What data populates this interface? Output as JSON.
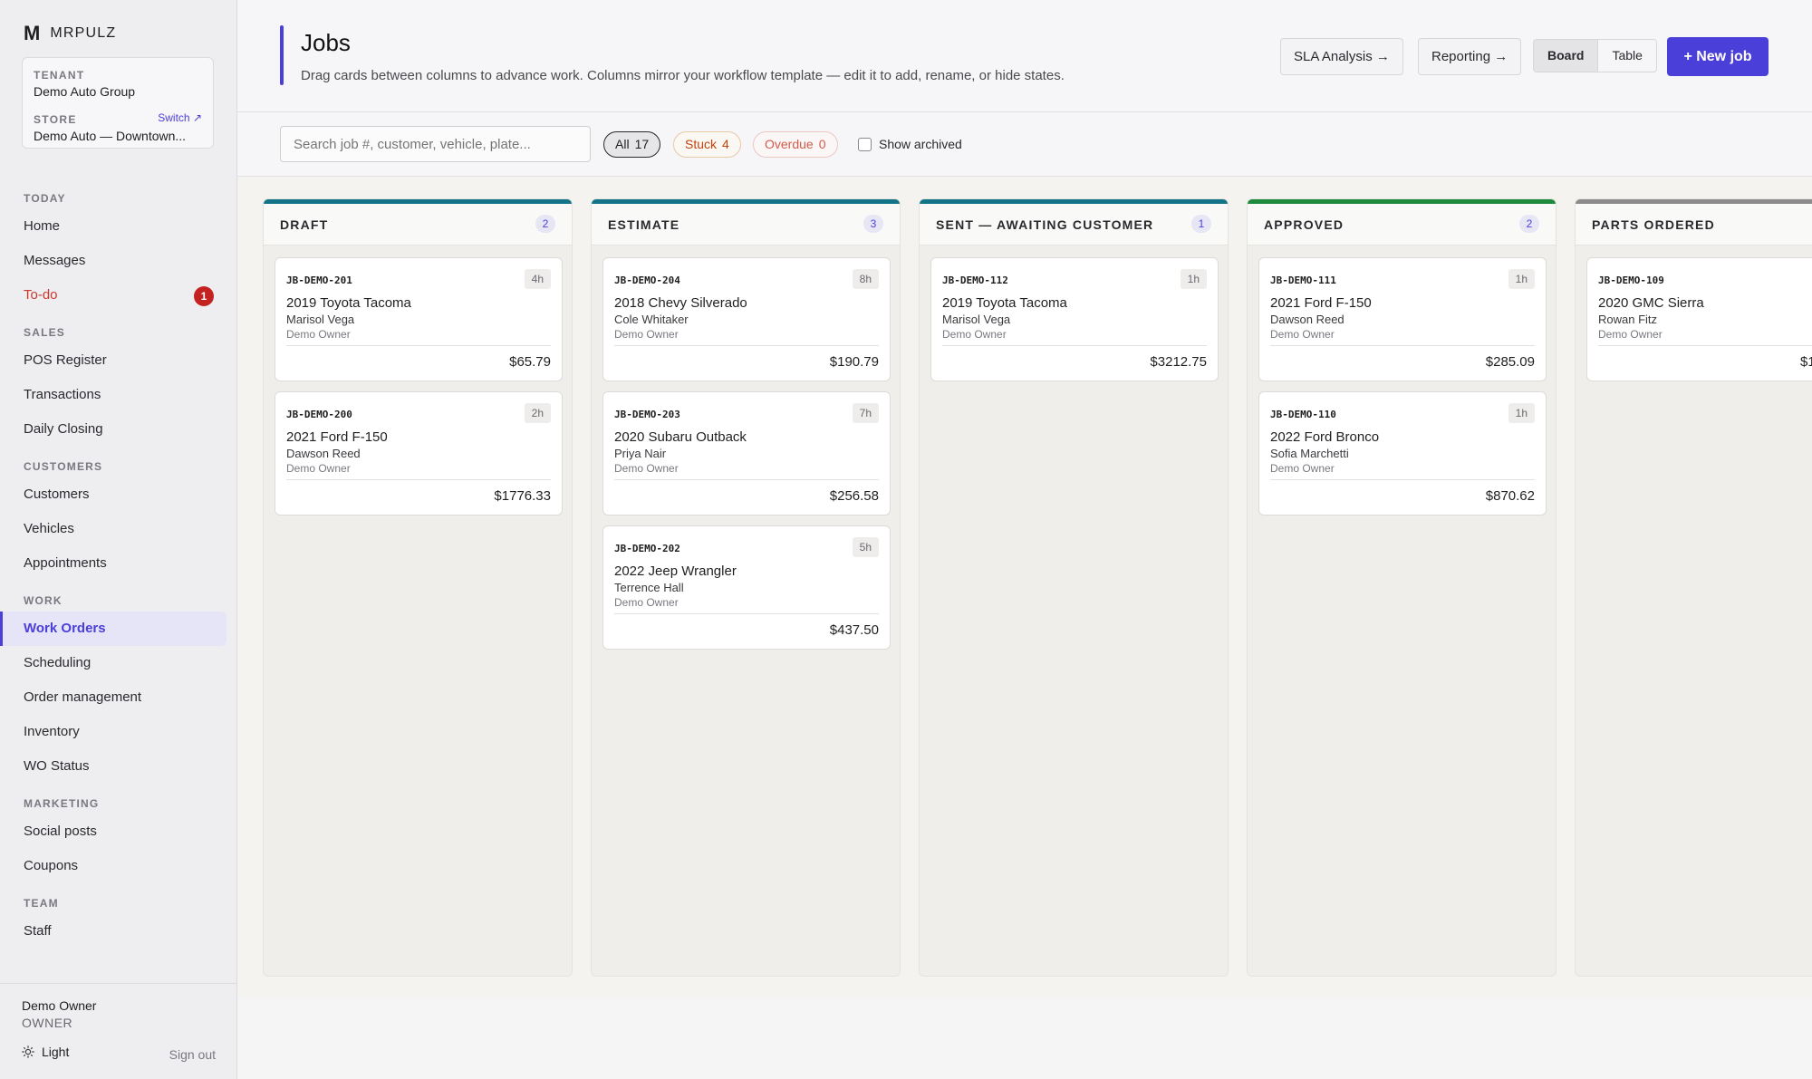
{
  "brand": {
    "mark": "M",
    "name": "MRPULZ"
  },
  "context": {
    "tenant_label": "TENANT",
    "tenant_value": "Demo Auto Group",
    "store_label": "STORE",
    "store_value": "Demo Auto — Downtown...",
    "switch_label": "Switch ↗"
  },
  "nav": {
    "today_label": "TODAY",
    "home": "Home",
    "messages": "Messages",
    "todo": "To-do",
    "todo_badge": "1",
    "sales_label": "SALES",
    "pos": "POS Register",
    "transactions": "Transactions",
    "daily_closing": "Daily Closing",
    "customers_label": "CUSTOMERS",
    "customers": "Customers",
    "vehicles": "Vehicles",
    "appointments": "Appointments",
    "work_label": "WORK",
    "work_orders": "Work Orders",
    "scheduling": "Scheduling",
    "order_management": "Order management",
    "inventory": "Inventory",
    "wo_status": "WO Status",
    "marketing_label": "MARKETING",
    "social_posts": "Social posts",
    "coupons": "Coupons",
    "team_label": "TEAM",
    "staff": "Staff"
  },
  "user": {
    "name": "Demo Owner",
    "role": "OWNER",
    "theme": "Light",
    "signout": "Sign out"
  },
  "header": {
    "title": "Jobs",
    "subtitle": "Drag cards between columns to advance work. Columns mirror your workflow template — edit it to add, rename, or hide states.",
    "sla": "SLA Analysis →",
    "reporting": "Reporting →",
    "view_board": "Board",
    "view_table": "Table",
    "new_job": "+ New job"
  },
  "filters": {
    "search_placeholder": "Search job #, customer, vehicle, plate...",
    "all_label": "All",
    "all_count": "17",
    "stuck_label": "Stuck",
    "stuck_count": "4",
    "overdue_label": "Overdue",
    "overdue_count": "0",
    "archived_label": "Show archived"
  },
  "colors": {
    "accent": "#4b3fd9",
    "draft": "#137387",
    "estimate": "#137387",
    "sent": "#137387",
    "approved": "#1e8a3c",
    "parts_ordered": "#8c8b8e"
  },
  "columns": [
    {
      "title": "DRAFT",
      "count": "2",
      "cards": [
        {
          "id": "JB-DEMO-201",
          "age": "4h",
          "vehicle": "2019 Toyota Tacoma",
          "customer": "Marisol Vega",
          "owner": "Demo Owner",
          "amount": "$65.79"
        },
        {
          "id": "JB-DEMO-200",
          "age": "2h",
          "vehicle": "2021 Ford F-150",
          "customer": "Dawson Reed",
          "owner": "Demo Owner",
          "amount": "$1776.33"
        }
      ]
    },
    {
      "title": "ESTIMATE",
      "count": "3",
      "cards": [
        {
          "id": "JB-DEMO-204",
          "age": "8h",
          "vehicle": "2018 Chevy Silverado",
          "customer": "Cole Whitaker",
          "owner": "Demo Owner",
          "amount": "$190.79"
        },
        {
          "id": "JB-DEMO-203",
          "age": "7h",
          "vehicle": "2020 Subaru Outback",
          "customer": "Priya Nair",
          "owner": "Demo Owner",
          "amount": "$256.58"
        },
        {
          "id": "JB-DEMO-202",
          "age": "5h",
          "vehicle": "2022 Jeep Wrangler",
          "customer": "Terrence Hall",
          "owner": "Demo Owner",
          "amount": "$437.50"
        }
      ]
    },
    {
      "title": "SENT — AWAITING CUSTOMER",
      "count": "1",
      "cards": [
        {
          "id": "JB-DEMO-112",
          "age": "1h",
          "vehicle": "2019 Toyota Tacoma",
          "customer": "Marisol Vega",
          "owner": "Demo Owner",
          "amount": "$3212.75"
        }
      ]
    },
    {
      "title": "APPROVED",
      "count": "2",
      "cards": [
        {
          "id": "JB-DEMO-111",
          "age": "1h",
          "vehicle": "2021 Ford F-150",
          "customer": "Dawson Reed",
          "owner": "Demo Owner",
          "amount": "$285.09"
        },
        {
          "id": "JB-DEMO-110",
          "age": "1h",
          "vehicle": "2022 Ford Bronco",
          "customer": "Sofia Marchetti",
          "owner": "Demo Owner",
          "amount": "$870.62"
        }
      ]
    },
    {
      "title": "PARTS ORDERED",
      "count": "",
      "cards": [
        {
          "id": "JB-DEMO-109",
          "age": "",
          "vehicle": "2020 GMC Sierra",
          "customer": "Rowan Fitz",
          "owner": "Demo Owner",
          "amount": "$1"
        }
      ]
    }
  ]
}
